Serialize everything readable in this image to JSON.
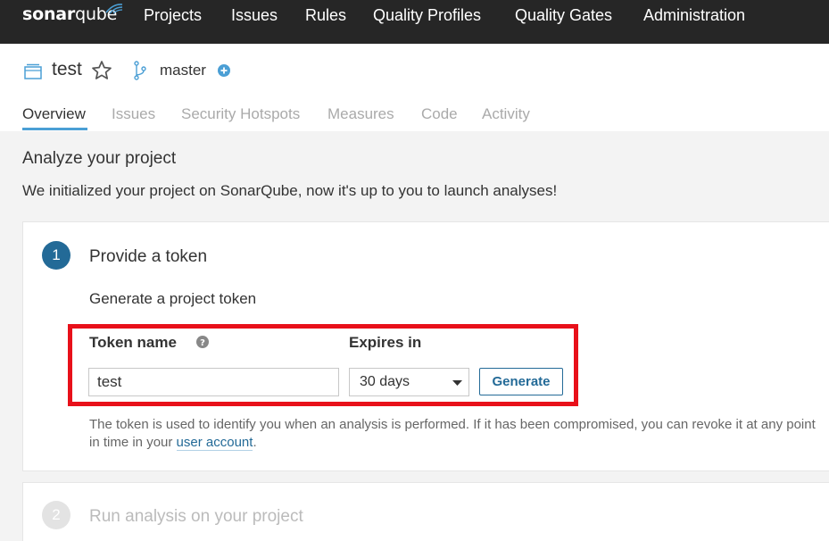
{
  "topnav": {
    "logo_bold": "sonar",
    "logo_light": "qube",
    "items": [
      "Projects",
      "Issues",
      "Rules",
      "Quality Profiles",
      "Quality Gates",
      "Administration"
    ]
  },
  "project": {
    "name": "test",
    "branch": "master"
  },
  "tabs": [
    "Overview",
    "Issues",
    "Security Hotspots",
    "Measures",
    "Code",
    "Activity"
  ],
  "page": {
    "title": "Analyze your project",
    "subtitle": "We initialized your project on SonarQube, now it's up to you to launch analyses!"
  },
  "step1": {
    "number": "1",
    "title": "Provide a token",
    "subtitle": "Generate a project token",
    "token_label": "Token name",
    "token_value": "test",
    "expires_label": "Expires in",
    "expires_value": "30 days",
    "generate_label": "Generate",
    "note_text": "The token is used to identify you when an analysis is performed. If it has been compromised, you can revoke it at any point in time in your ",
    "note_link": "user account",
    "note_end": "."
  },
  "step2": {
    "number": "2",
    "title": "Run analysis on your project"
  },
  "colors": {
    "topbar": "#262626",
    "accent": "#236a97",
    "highlight": "#e8101a",
    "tab_active_underline": "#4b9fd5"
  }
}
